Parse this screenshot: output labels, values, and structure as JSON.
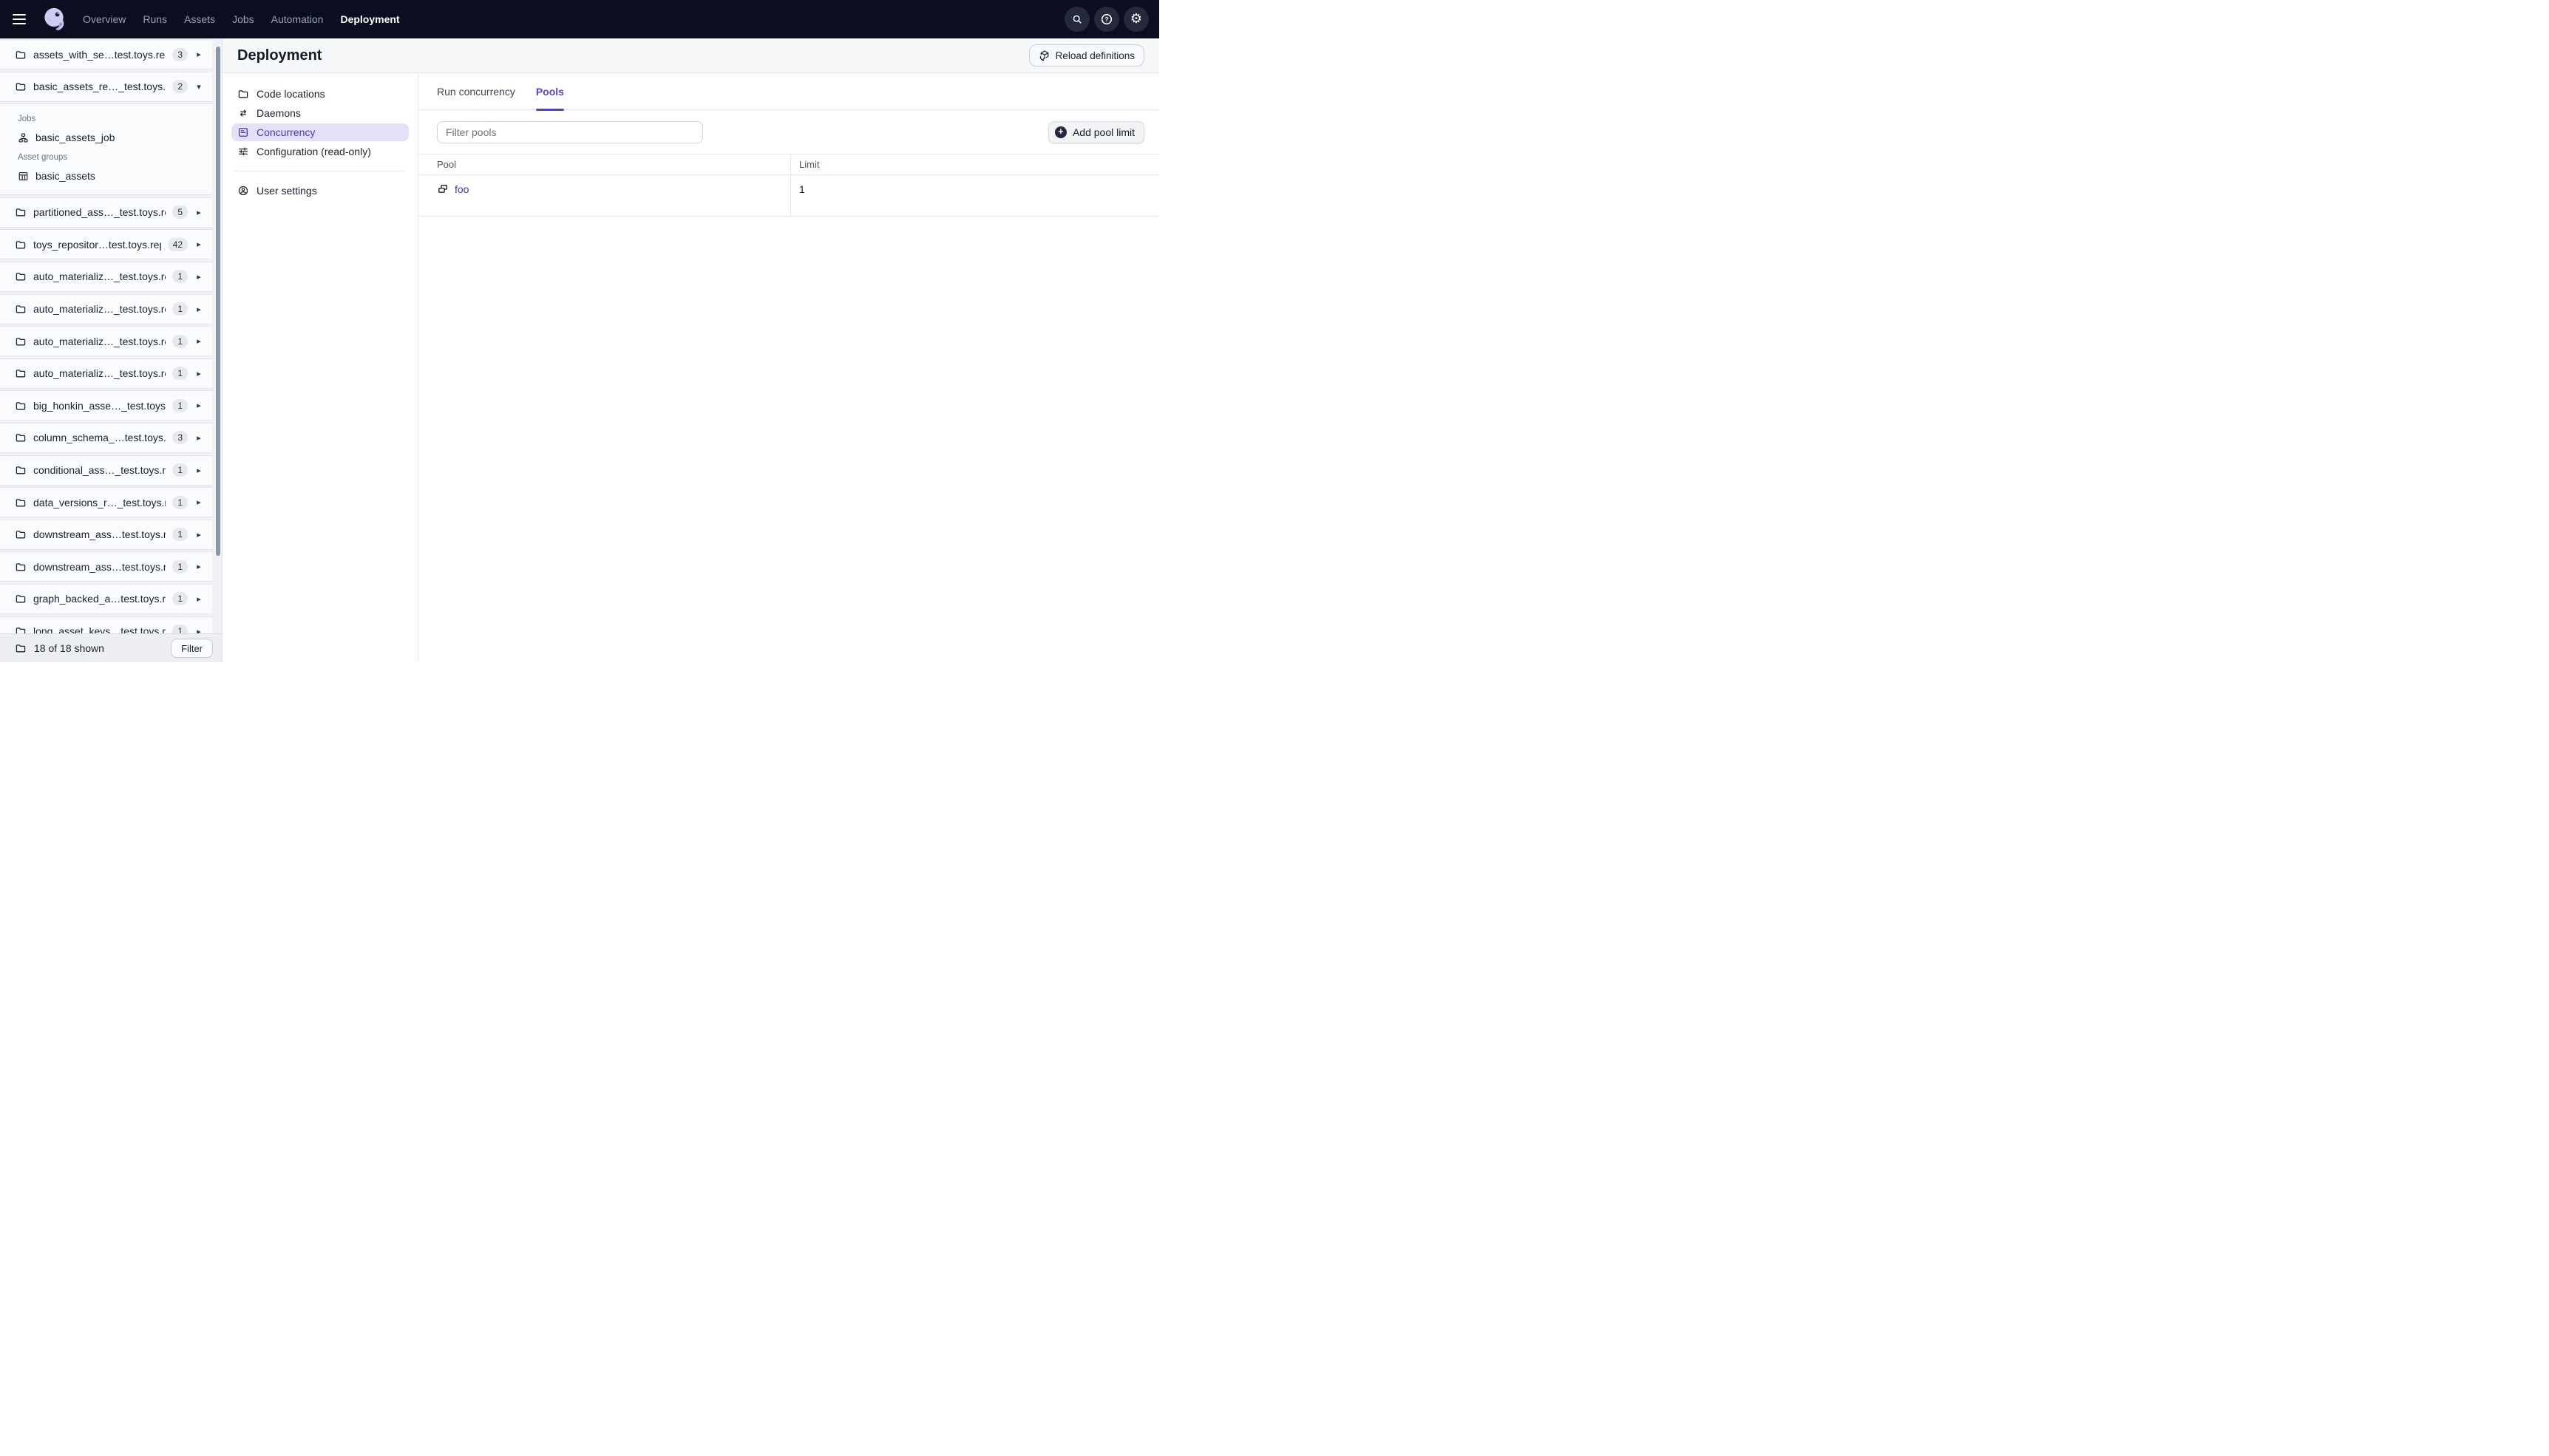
{
  "icons": {
    "chevron_right": "▸",
    "chevron_down": "▾",
    "gear": "⚙",
    "plus": "+"
  },
  "topnav": {
    "items": [
      "Overview",
      "Runs",
      "Assets",
      "Jobs",
      "Automation",
      "Deployment"
    ],
    "active_item": "Deployment"
  },
  "sidebar": {
    "repos": [
      {
        "name": "assets_with_se…test.toys.repo",
        "count": "3"
      },
      {
        "name": "basic_assets_re…_test.toys.rep",
        "count": "2",
        "expanded": true
      },
      {
        "name": "partitioned_ass…_test.toys.rep",
        "count": "5"
      },
      {
        "name": "toys_repositor…test.toys.repo",
        "count": "42"
      },
      {
        "name": "auto_materializ…_test.toys.repo",
        "count": "1"
      },
      {
        "name": "auto_materializ…_test.toys.repo",
        "count": "1"
      },
      {
        "name": "auto_materializ…_test.toys.repo",
        "count": "1"
      },
      {
        "name": "auto_materializ…_test.toys.repo",
        "count": "1"
      },
      {
        "name": "big_honkin_asse…_test.toys.rep",
        "count": "1"
      },
      {
        "name": "column_schema_…test.toys.rep",
        "count": "3"
      },
      {
        "name": "conditional_ass…_test.toys.repo",
        "count": "1"
      },
      {
        "name": "data_versions_r…_test.toys.rep",
        "count": "1"
      },
      {
        "name": "downstream_ass…test.toys.rep",
        "count": "1"
      },
      {
        "name": "downstream_ass…test.toys.rep",
        "count": "1"
      },
      {
        "name": "graph_backed_a…test.toys.repo",
        "count": "1"
      },
      {
        "name": "long_asset_keys…test.toys.rep",
        "count": "1"
      }
    ],
    "expanded_sections": {
      "jobs_label": "Jobs",
      "job_item": "basic_assets_job",
      "asset_groups_label": "Asset groups",
      "asset_group_item": "basic_assets"
    },
    "footer": {
      "shown": "18 of 18 shown",
      "filter_button": "Filter"
    }
  },
  "page": {
    "title": "Deployment",
    "reload_button": "Reload definitions"
  },
  "settings_nav": {
    "items": [
      "Code locations",
      "Daemons",
      "Concurrency",
      "Configuration (read-only)"
    ],
    "selected": "Concurrency",
    "user_settings": "User settings"
  },
  "tabs": {
    "items": [
      "Run concurrency",
      "Pools"
    ],
    "active": "Pools"
  },
  "pools": {
    "filter_placeholder": "Filter pools",
    "add_button": "Add pool limit",
    "table": {
      "columns": [
        "Pool",
        "Limit"
      ],
      "rows": [
        {
          "pool": "foo",
          "limit": "1"
        }
      ]
    }
  },
  "colors": {
    "accent": "#4F43DD",
    "link": "#3D35B4",
    "nav_bg": "#0A0E1F",
    "selected_pill": "#E3E0F8"
  }
}
